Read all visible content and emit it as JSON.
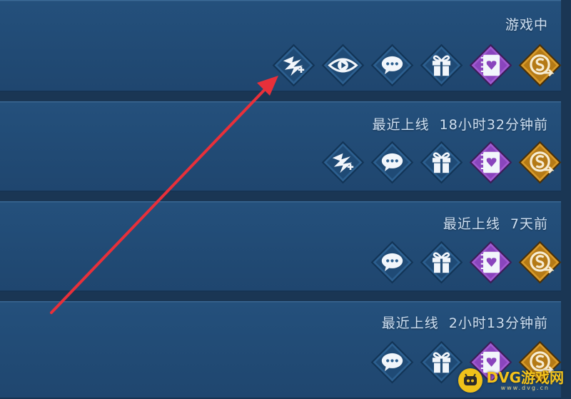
{
  "rows": [
    {
      "status": "游戏中",
      "status_time": "",
      "icons": [
        "team-up",
        "spectate",
        "chat",
        "gift",
        "intimacy",
        "transfer"
      ]
    },
    {
      "status": "最近上线",
      "status_time": "18小时32分钟前",
      "icons": [
        "team-up",
        "chat",
        "gift",
        "intimacy",
        "transfer"
      ]
    },
    {
      "status": "最近上线",
      "status_time": "7天前",
      "icons": [
        "chat",
        "gift",
        "intimacy",
        "transfer"
      ]
    },
    {
      "status": "最近上线",
      "status_time": "2小时13分钟前",
      "icons": [
        "chat",
        "gift",
        "intimacy",
        "transfer"
      ]
    }
  ],
  "watermark": {
    "brand": "DVG游戏网",
    "sub": "www.dvg.cn"
  },
  "colors": {
    "panel": "#24507c",
    "background": "#1a3654",
    "arrow": "#e8303a",
    "purple_icon": "#a05ad0",
    "gold_icon": "#d89a2a",
    "blue_icon": "#2c5f8f"
  }
}
